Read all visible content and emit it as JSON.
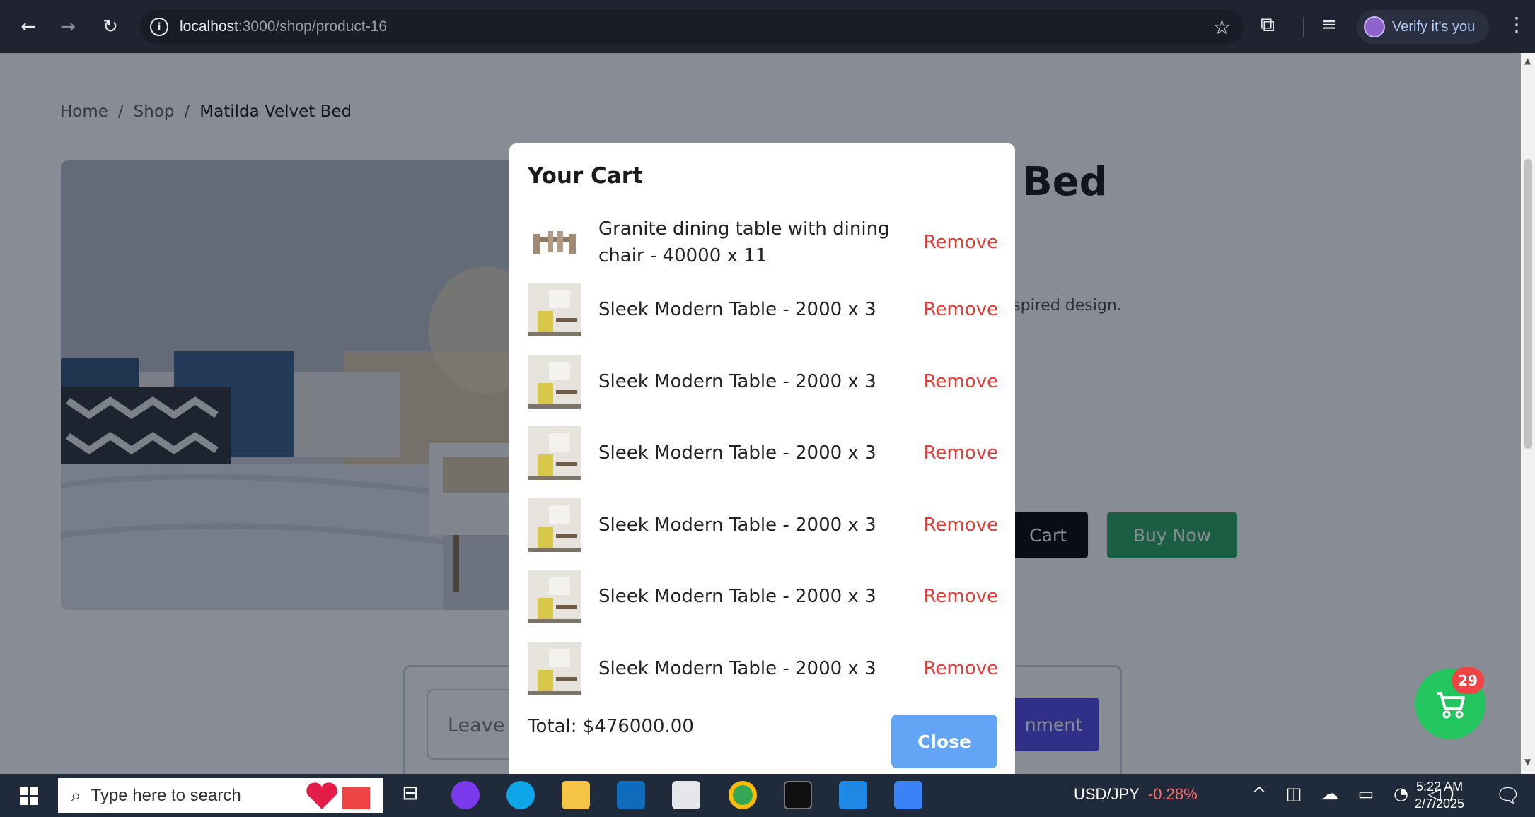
{
  "browser": {
    "url_host": "localhost",
    "url_path": ":3000/shop/product-16",
    "profile_label": "Verify it's you"
  },
  "breadcrumb": {
    "home": "Home",
    "sep": "/",
    "shop": "Shop",
    "current": "Matilda Velvet Bed"
  },
  "product": {
    "title": "lvet Bed",
    "description": "th a retro-inspired design.",
    "add_to_cart": "Cart",
    "buy_now": "Buy Now"
  },
  "comment": {
    "placeholder": "Leave",
    "submit": "nment"
  },
  "cart": {
    "title": "Your Cart",
    "remove_label": "Remove",
    "items": [
      {
        "name": "Granite dining table with dining chair - 40000 x 11"
      },
      {
        "name": "Sleek Modern Table - 2000 x 3"
      },
      {
        "name": "Sleek Modern Table - 2000 x 3"
      },
      {
        "name": "Sleek Modern Table - 2000 x 3"
      },
      {
        "name": "Sleek Modern Table - 2000 x 3"
      },
      {
        "name": "Sleek Modern Table - 2000 x 3"
      },
      {
        "name": "Sleek Modern Table - 2000 x 3"
      }
    ],
    "total": "Total: $476000.00",
    "close": "Close"
  },
  "floating_cart": {
    "count": "29"
  },
  "taskbar": {
    "search_placeholder": "Type here to search",
    "ticker_symbol": "USD/JPY",
    "ticker_change": "-0.28%",
    "time": "5:22 AM",
    "date": "2/7/2025",
    "notifications": "1"
  }
}
